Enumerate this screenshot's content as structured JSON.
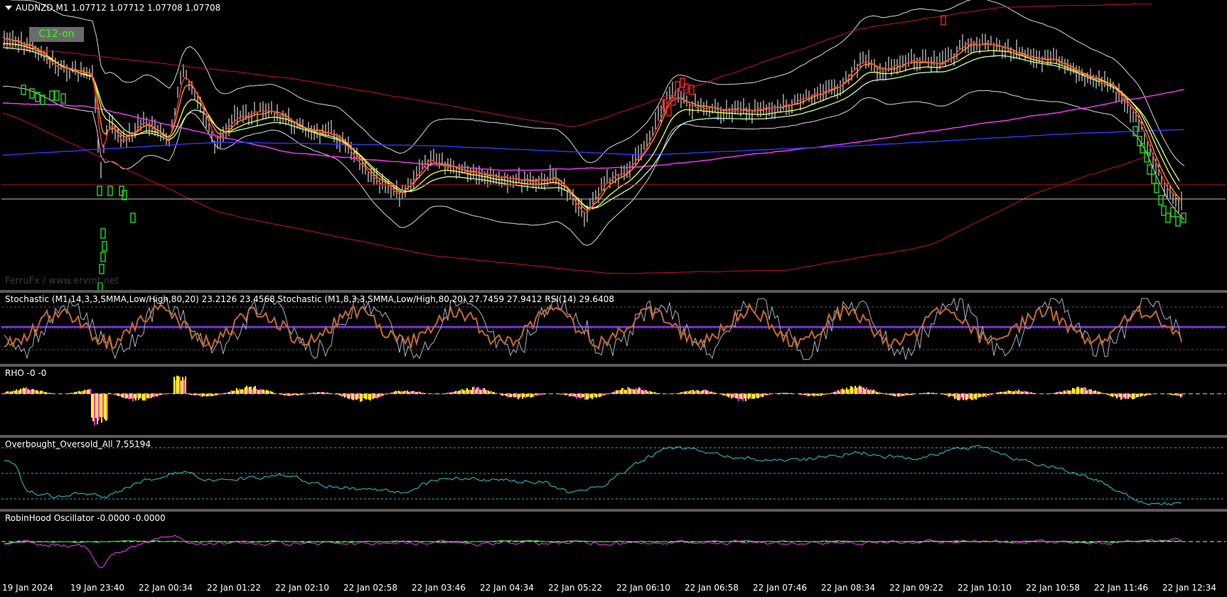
{
  "symbol_header": "AUDNZD,M1  1.07712 1.07712 1.07708 1.07708",
  "c12_label": "C12-on",
  "watermark": "FerruFx / www.ervmt.net",
  "panes": {
    "stoch": "Stochastic (M1,14,3,3,SMMA,Low/High,80,20) 23.2126 23.4568  Stochastic (M1,8,3,3,SMMA,Low/High,80,20) 27.7459 27.9412  RSI(14) 29.6408",
    "rho": "RHO -0 -0",
    "obos": "Overbought_Oversold_All 7.55194",
    "robin": "RobinHood Oscillator -0.0000 -0.0000"
  },
  "time_ticks": [
    "19 Jan 2024",
    "19 Jan 23:40",
    "22 Jan 00:34",
    "22 Jan 01:22",
    "22 Jan 02:10",
    "22 Jan 02:58",
    "22 Jan 03:46",
    "22 Jan 04:34",
    "22 Jan 05:22",
    "22 Jan 06:10",
    "22 Jan 06:58",
    "22 Jan 07:46",
    "22 Jan 08:34",
    "22 Jan 09:22",
    "22 Jan 10:10",
    "22 Jan 10:58",
    "22 Jan 11:46",
    "22 Jan 12:34"
  ],
  "colors": {
    "background": "#000000",
    "separator": "#5a5a5a",
    "candles": "#ffffff",
    "ema_fast": "#ff3b2f",
    "ema_orange": "#ff9a2a",
    "ema_yellow": "#ffff3a",
    "ema_lightgreen": "#b7ffb0",
    "ema_magenta": "#ff37ff",
    "ema_blue": "#2b3bff",
    "bands_white": "#d8d8d8",
    "bands_red": "#c8141e",
    "signal_green": "#22dd22",
    "signal_red": "#ff2020",
    "stoch_brown": "#c46a2f",
    "stoch_gray": "#a8b0c8",
    "rsi_purple": "#8a3cff",
    "rho_yellow": "#ffff00",
    "rho_magenta": "#ff33ff",
    "obos_cyan": "#30c8d0",
    "robin_magenta": "#ff33ff",
    "robin_green": "#3cff3c"
  }
}
